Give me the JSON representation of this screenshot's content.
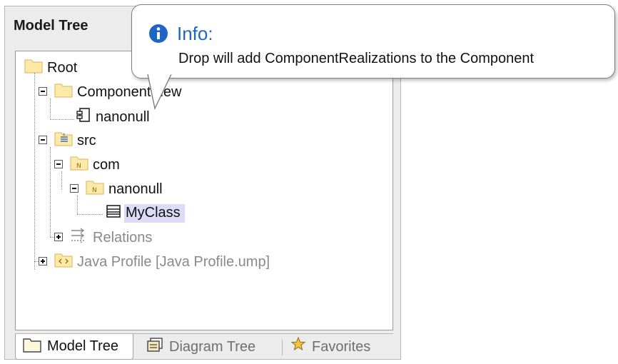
{
  "panel": {
    "title": "Model Tree"
  },
  "tree": {
    "root": "Root",
    "component_view": "ComponentView",
    "component": "nanonull",
    "src": "src",
    "com": "com",
    "nanonull_pkg": "nanonull",
    "myclass": "MyClass",
    "relations": "Relations",
    "java_profile": "Java Profile [Java Profile.ump]"
  },
  "tabs": [
    {
      "label": "Model Tree",
      "icon": "folder-icon",
      "active": true
    },
    {
      "label": "Diagram Tree",
      "icon": "diagram-tree-icon",
      "active": false
    },
    {
      "label": "Favorites",
      "icon": "favorites-icon",
      "active": false
    }
  ],
  "tooltip": {
    "title": "Info:",
    "message": "Drop will add ComponentRealizations to the Component",
    "icon": "info-icon"
  },
  "colors": {
    "selection": "#dcdcf8",
    "folder": "#fde9a8",
    "info_blue": "#1e66c4"
  }
}
